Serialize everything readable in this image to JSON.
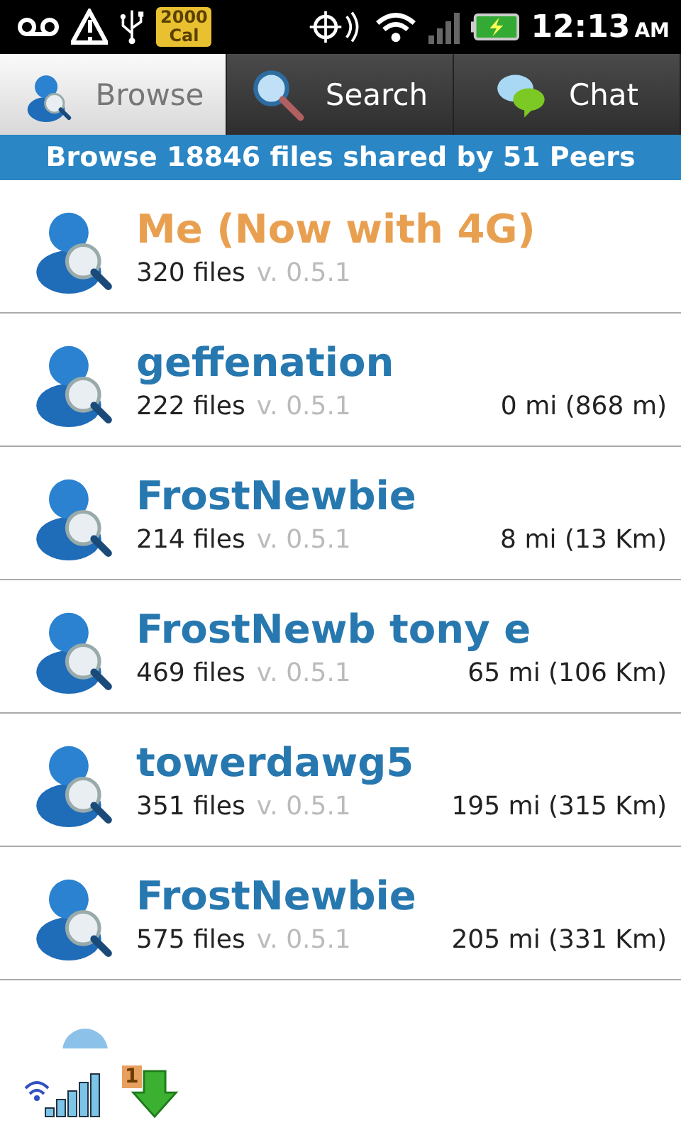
{
  "status_bar": {
    "calendar_badge": [
      "2000",
      "Cal"
    ],
    "time": "12:13",
    "ampm": "AM"
  },
  "tabs": [
    {
      "label": "Browse",
      "kind": "browse",
      "selected": true
    },
    {
      "label": "Search",
      "kind": "search",
      "selected": false
    },
    {
      "label": "Chat",
      "kind": "chat",
      "selected": false
    }
  ],
  "header": "Browse 18846 files shared by 51 Peers",
  "peers": [
    {
      "kind": "self",
      "name": "Me (Now with 4G)",
      "files": "320 files",
      "version": "v. 0.5.1"
    },
    {
      "kind": "peer",
      "name": "geffenation",
      "files": "222 files",
      "version": "v. 0.5.1",
      "distance": "0 mi (868 m)"
    },
    {
      "kind": "peer",
      "name": "FrostNewbie",
      "files": "214 files",
      "version": "v. 0.5.1",
      "distance": "8 mi (13 Km)"
    },
    {
      "kind": "peer",
      "name": "FrostNewb tony e",
      "files": "469 files",
      "version": "v. 0.5.1",
      "distance": "65 mi (106 Km)"
    },
    {
      "kind": "peer",
      "name": "towerdawg5",
      "files": "351 files",
      "version": "v. 0.5.1",
      "distance": "195 mi (315 Km)"
    },
    {
      "kind": "peer",
      "name": "FrostNewbie",
      "files": "575 files",
      "version": "v. 0.5.1",
      "distance": "205 mi (331 Km)"
    }
  ],
  "bottom_bar": {
    "download_count": "1"
  }
}
